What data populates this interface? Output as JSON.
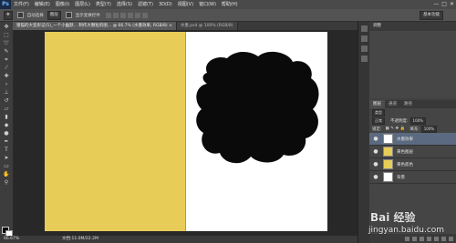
{
  "app": {
    "logo": "Ps",
    "menu": [
      "文件(F)",
      "编辑(E)",
      "图像(I)",
      "图层(L)",
      "类型(Y)",
      "选择(S)",
      "滤镜(T)",
      "3D(D)",
      "视图(V)",
      "窗口(W)",
      "帮助(H)"
    ],
    "window_controls": [
      "—",
      "□",
      "✕"
    ]
  },
  "options": {
    "auto_select": "自动选择",
    "auto_select_target": "图层",
    "show_transform": "显示变换控件",
    "workspace": "基本功能"
  },
  "tabs": [
    {
      "label": "猪猫的大变形记(5)_一个小幽默... 制作大颗粒的图... @ 66.7% (水墨效果, RGB/8) ×",
      "active": true
    },
    {
      "label": "水墨.psd @ 100% (RGB/8)",
      "active": false
    }
  ],
  "canvas": {
    "left_color": "#e7cc57",
    "right_color": "#ffffff",
    "ink_color": "#0a0a0a"
  },
  "status": {
    "zoom": "66.67%",
    "doc_size": "文档:11.0M/22.2M"
  },
  "adjust_panel": {
    "title": "调整"
  },
  "layers_panel": {
    "tabs": [
      "图层",
      "通道",
      "路径"
    ],
    "kind_label": "类型",
    "blend_mode": "正常",
    "opacity_label": "不透明度:",
    "opacity_value": "100%",
    "lock_label": "锁定:",
    "fill_label": "填充:",
    "fill_value": "100%",
    "layers": [
      {
        "name": "水墨效果",
        "thumb": "#ffffff",
        "selected": true
      },
      {
        "name": "黄色图层",
        "thumb": "#e7cc57",
        "selected": false
      },
      {
        "name": "黄色底色",
        "thumb": "#e7cc57",
        "selected": false
      },
      {
        "name": "背景",
        "thumb": "#ffffff",
        "selected": false
      }
    ]
  },
  "watermark": {
    "logo": "Bai 经验",
    "url": "jingyan.baidu.com"
  }
}
